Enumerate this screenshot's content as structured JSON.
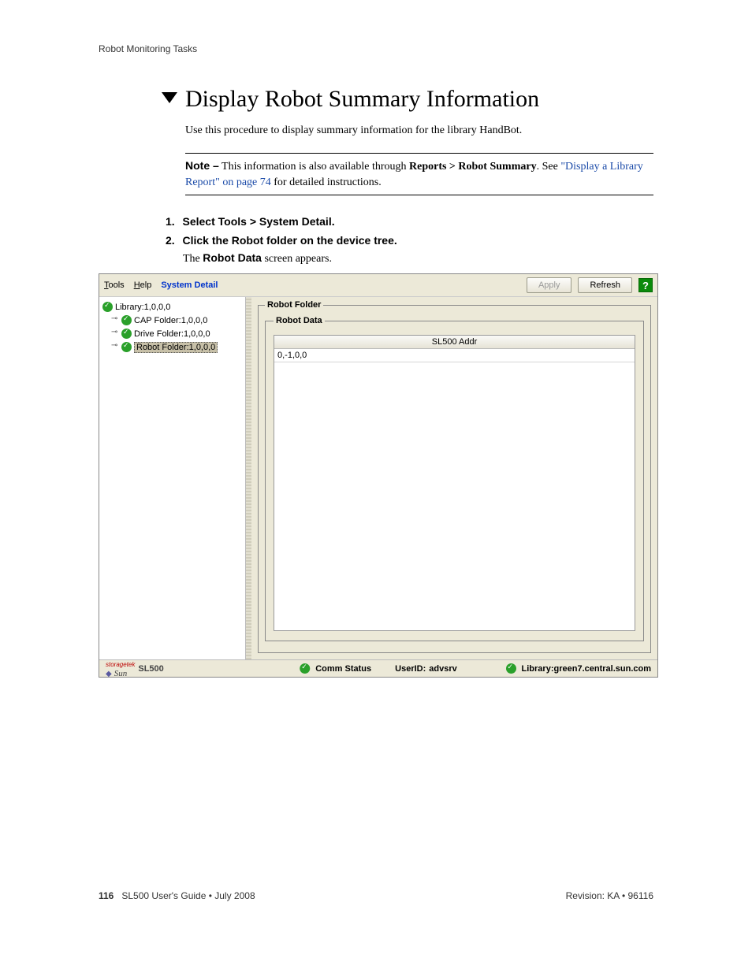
{
  "running_head": "Robot Monitoring Tasks",
  "section_title": "Display Robot Summary Information",
  "intro": "Use this procedure to display summary information for the library HandBot.",
  "note": {
    "label": "Note –",
    "text_before": " This information is also available through ",
    "bold1": "Reports > Robot Summary",
    "text_after1": ". See ",
    "link": "\"Display a Library Report\" on page 74",
    "text_after2": " for detailed instructions."
  },
  "steps": [
    {
      "num": "1.",
      "text": "Select Tools > System Detail."
    },
    {
      "num": "2.",
      "text": "Click the Robot folder on the device tree."
    }
  ],
  "step_sub_pre": "The ",
  "step_sub_bold": "Robot Data",
  "step_sub_post": " screen appears.",
  "menu": {
    "tools": "Tools",
    "help": "Help",
    "system_detail": "System Detail"
  },
  "buttons": {
    "apply": "Apply",
    "refresh": "Refresh"
  },
  "tree": {
    "library": "Library:1,0,0,0",
    "cap": "CAP Folder:1,0,0,0",
    "drive": "Drive Folder:1,0,0,0",
    "robot": "Robot Folder:1,0,0,0"
  },
  "panel": {
    "outer_legend": "Robot Folder",
    "inner_legend": "Robot Data",
    "column_header": "SL500 Addr",
    "row1": "0,-1,0,0"
  },
  "status": {
    "brand_small": "storagetek",
    "brand_sun": "Sun",
    "brand_model": "SL500",
    "comm": "Comm Status",
    "userid_label": "UserID:",
    "userid_value": "advsrv",
    "library_label": "Library:",
    "library_value": "green7.central.sun.com"
  },
  "footer": {
    "page": "116",
    "left": "SL500 User's Guide  •  July 2008",
    "right": "Revision: KA  •  96116"
  }
}
